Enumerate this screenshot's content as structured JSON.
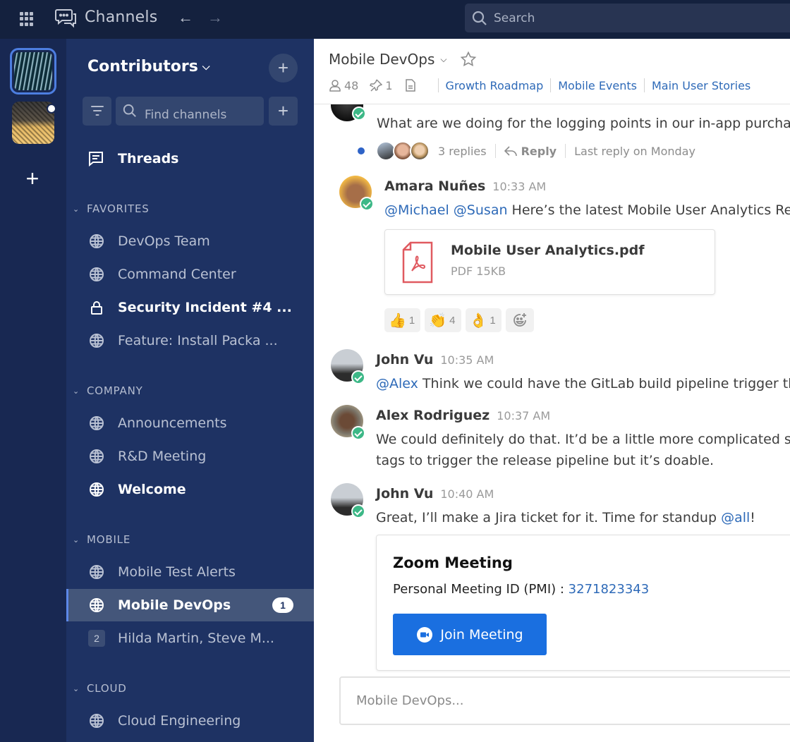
{
  "topbar": {
    "app_title": "Channels",
    "back_label": "←",
    "forward_label": "→",
    "search_placeholder": "Search"
  },
  "rail": {
    "teams": [
      {
        "name": "team-1",
        "active": true
      },
      {
        "name": "team-2",
        "unread": true
      }
    ],
    "add_label": "+"
  },
  "sidebar": {
    "team_name": "Contributors",
    "chevron": "⌄",
    "add_label": "+",
    "find_placeholder": "Find channels",
    "threads_label": "Threads",
    "sections": [
      {
        "title": "FAVORITES",
        "channels": [
          {
            "label": "DevOps Team",
            "icon": "globe-icon"
          },
          {
            "label": "Command Center",
            "icon": "globe-icon"
          },
          {
            "label": "Security Incident #4 ...",
            "icon": "lock-icon",
            "bold": true
          },
          {
            "label": "Feature: Install Packa ...",
            "icon": "globe-icon"
          }
        ]
      },
      {
        "title": "COMPANY",
        "channels": [
          {
            "label": "Announcements",
            "icon": "globe-icon"
          },
          {
            "label": "R&D Meeting",
            "icon": "globe-icon"
          },
          {
            "label": "Welcome",
            "icon": "globe-icon",
            "bold": true
          }
        ]
      },
      {
        "title": "MOBILE",
        "channels": [
          {
            "label": "Mobile Test Alerts",
            "icon": "globe-icon"
          },
          {
            "label": "Mobile DevOps",
            "icon": "globe-icon",
            "bold": true,
            "active": true,
            "badge": "1"
          },
          {
            "label": "Hilda Martin, Steve M...",
            "icon": "group-dm",
            "count": "2"
          }
        ]
      },
      {
        "title": "CLOUD",
        "channels": [
          {
            "label": "Cloud Engineering",
            "icon": "globe-icon"
          }
        ]
      }
    ]
  },
  "channel_header": {
    "title": "Mobile DevOps",
    "members": "48",
    "pinned": "1",
    "links": [
      "Growth Roadmap",
      "Mobile Events",
      "Main User Stories"
    ]
  },
  "messages": [
    {
      "text": "What are we doing for the logging points in our in-app purchase",
      "thread": {
        "replies": "3 replies",
        "reply_label": "Reply",
        "last_reply": "Last reply on Monday"
      }
    },
    {
      "author": "Amara Nuñes",
      "time": "10:33 AM",
      "mentions": "@Michael @Susan",
      "text": " Here’s the latest Mobile User Analytics Report",
      "file": {
        "name": "Mobile User Analytics.pdf",
        "meta": "PDF 15KB"
      },
      "reactions": [
        {
          "emoji": "👍",
          "count": "1"
        },
        {
          "emoji": "👏",
          "count": "4"
        },
        {
          "emoji": "👌",
          "count": "1"
        }
      ]
    },
    {
      "author": "John Vu",
      "time": "10:35 AM",
      "mentions": "@Alex",
      "text": " Think we could have the GitLab build pipeline trigger the"
    },
    {
      "author": "Alex Rodriguez",
      "time": "10:37 AM",
      "text": "We could definitely do that. It’d be a little more complicated since",
      "text2": "tags to trigger the release pipeline but it’s doable."
    },
    {
      "author": "John Vu",
      "time": "10:40 AM",
      "text": "Great, I’ll make a Jira ticket for it. Time for standup ",
      "mention_end": "@all",
      "text_end": "!",
      "meeting": {
        "title": "Zoom Meeting",
        "pmi_label": "Personal Meeting ID (PMI) : ",
        "pmi": "3271823343",
        "join_label": "Join Meeting"
      }
    }
  ],
  "composer": {
    "placeholder": "Mobile DevOps..."
  },
  "colors": {
    "accent": "#1a6fe0",
    "link": "#2e6ab8",
    "sidebar": "#1e3263",
    "online": "#3db887"
  }
}
